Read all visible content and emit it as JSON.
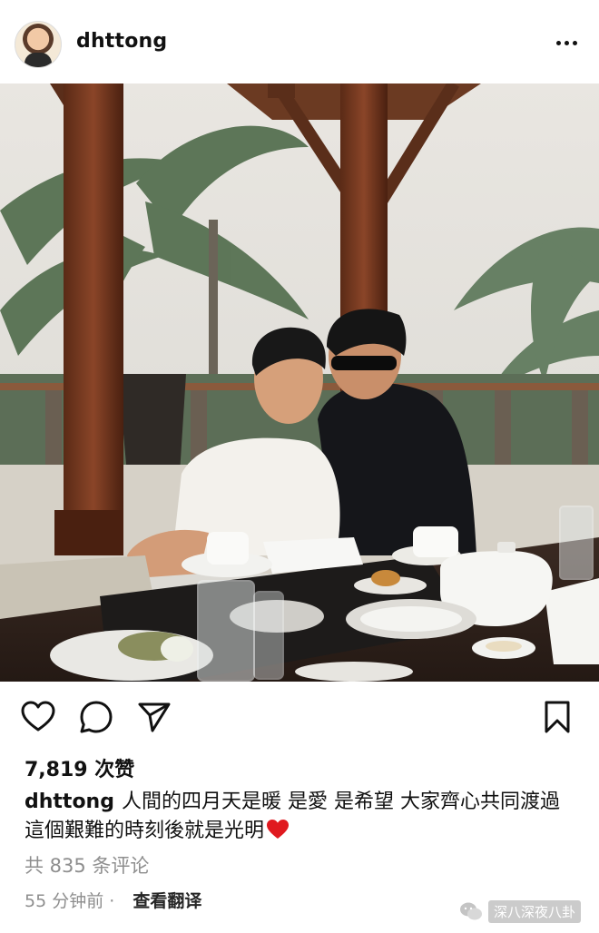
{
  "post": {
    "username": "dhttong",
    "likes": "7,819 次赞",
    "caption_user": "dhttong",
    "caption_text": "人間的四月天是暖 是愛 是希望 大家齊心共同渡過這個艱難的時刻後就是光明",
    "comments": "共 835 条评论",
    "time_ago": "55 分钟前",
    "translate": "查看翻译"
  },
  "icons": {
    "more": "more-options-icon",
    "like": "heart-icon",
    "comment": "comment-icon",
    "share": "send-icon",
    "save": "bookmark-icon"
  },
  "watermark": {
    "text": "深八深夜八卦"
  },
  "colors": {
    "text": "#111111",
    "muted": "#8e8e8e",
    "heart_emoji": "#e0191f"
  }
}
